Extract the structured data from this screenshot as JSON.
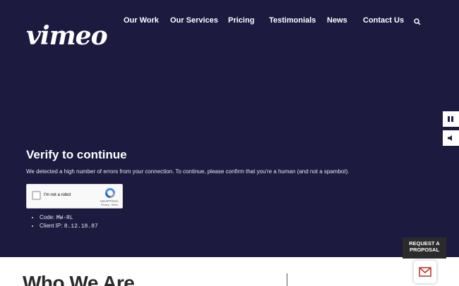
{
  "header": {
    "logo": "vimeo",
    "nav": [
      {
        "label": "Our Work"
      },
      {
        "label": "Our Services"
      },
      {
        "label": "Pricing"
      },
      {
        "label": "Testimonials"
      },
      {
        "label": "News"
      },
      {
        "label": "Contact Us"
      }
    ],
    "search_icon": "search-icon"
  },
  "verify": {
    "title": "Verify to continue",
    "message": "We detected a high number of errors from your connection. To continue, please confirm that you're a human (and not a spambot).",
    "recaptcha": {
      "label": "I'm not a robot",
      "brand": "reCAPTCHA",
      "links": "Privacy - Terms"
    },
    "details": [
      {
        "label": "Code: ",
        "value": "MW-RL"
      },
      {
        "label": "Client IP: ",
        "value": "8.12.18.87"
      }
    ]
  },
  "media_controls": {
    "pause_icon": "pause-icon",
    "mute_icon": "volume-icon"
  },
  "section": {
    "title": "Who We Are"
  },
  "proposal": {
    "label_line1": "REQUEST A",
    "label_line2": "PROPOSAL",
    "icon": "envelope-icon"
  },
  "colors": {
    "hero_bg": "#1c1a3f",
    "text": "#ffffff",
    "section_bg": "#ffffff"
  }
}
